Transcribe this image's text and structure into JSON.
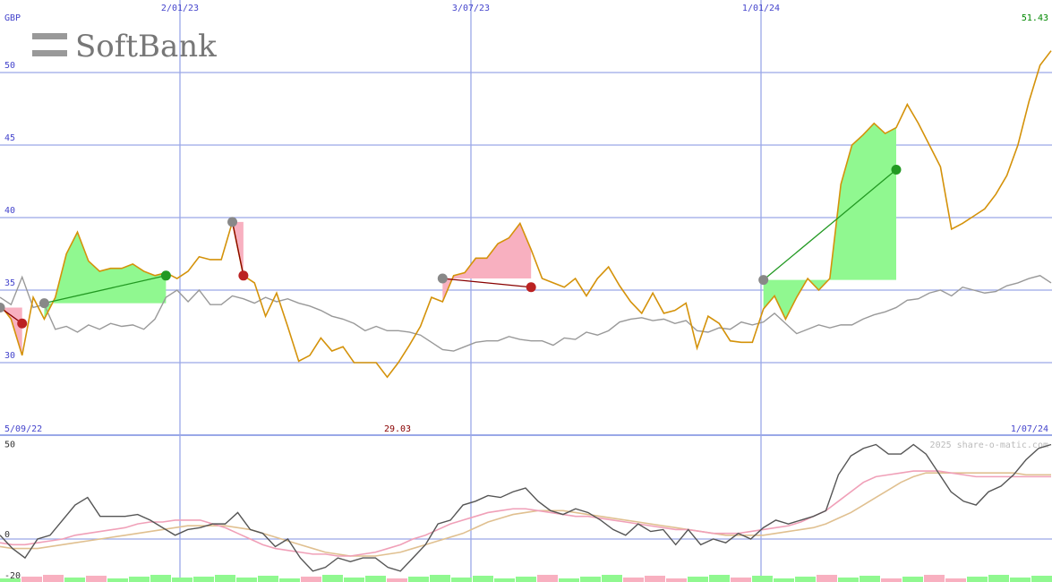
{
  "brand": {
    "name": "SoftBank"
  },
  "currency": "GBP",
  "last_price_label": "51.43",
  "min_price_label": "29.03",
  "start_date_label": "5/09/22",
  "end_date_label": "1/07/24",
  "watermark": "2025 share-o-matic.com",
  "colors": {
    "price": "#d4920a",
    "benchmark": "#999999",
    "grid": "#9aa8e8",
    "axis_text": "#4444cc",
    "gain_fill": "#90f890",
    "loss_fill": "#f8b0c0",
    "buy_marker": "#888888",
    "gain_marker": "#229922",
    "loss_marker": "#bb2222",
    "gain_line": "#229922",
    "loss_line": "#880000",
    "osc": "#555555",
    "osc_fast": "#f0a0b8",
    "osc_slow": "#e0c090",
    "last_label": "#008800",
    "min_label": "#880000"
  },
  "chart_data": [
    {
      "type": "line",
      "x_date_ticks": [
        "2/01/23",
        "3/07/23",
        "1/01/24"
      ],
      "ylabel": "GBP",
      "ylim": [
        27.5,
        52
      ],
      "y_ticks": [
        30,
        35,
        40,
        45,
        50
      ],
      "grid": true,
      "price": [
        34.0,
        33.0,
        30.5,
        34.5,
        33.0,
        34.5,
        37.5,
        39.0,
        37.0,
        36.3,
        36.5,
        36.5,
        36.8,
        36.3,
        36.0,
        36.2,
        35.8,
        36.3,
        37.3,
        37.1,
        37.1,
        39.7,
        36.0,
        35.5,
        33.2,
        34.8,
        32.5,
        30.1,
        30.5,
        31.7,
        30.8,
        31.1,
        30.0,
        30.0,
        30.0,
        29.0,
        30.0,
        31.2,
        32.5,
        34.5,
        34.2,
        36.0,
        36.2,
        37.2,
        37.2,
        38.2,
        38.6,
        39.6,
        37.8,
        35.8,
        35.5,
        35.2,
        35.8,
        34.6,
        35.8,
        36.6,
        35.3,
        34.2,
        33.4,
        34.8,
        33.4,
        33.6,
        34.1,
        31.0,
        33.2,
        32.7,
        31.5,
        31.4,
        31.4,
        33.7,
        34.6,
        33.0,
        34.5,
        35.8,
        35.0,
        35.8,
        42.3,
        45.0,
        45.7,
        46.5,
        45.8,
        46.2,
        47.8,
        46.5,
        45.0,
        43.5,
        39.2,
        39.6,
        40.1,
        40.6,
        41.6,
        42.9,
        45.0,
        48.0,
        50.5,
        51.5
      ],
      "benchmark": [
        34.5,
        34.0,
        35.9,
        33.8,
        34.0,
        32.3,
        32.5,
        32.1,
        32.6,
        32.3,
        32.7,
        32.5,
        32.6,
        32.3,
        33.0,
        34.5,
        35.0,
        34.2,
        35.0,
        34.0,
        34.0,
        34.6,
        34.4,
        34.1,
        34.5,
        34.2,
        34.4,
        34.1,
        33.9,
        33.6,
        33.2,
        33.0,
        32.7,
        32.2,
        32.5,
        32.2,
        32.2,
        32.1,
        31.9,
        31.4,
        30.9,
        30.8,
        31.1,
        31.4,
        31.5,
        31.5,
        31.8,
        31.6,
        31.5,
        31.5,
        31.2,
        31.7,
        31.6,
        32.1,
        31.9,
        32.2,
        32.8,
        33.0,
        33.1,
        32.9,
        33.0,
        32.7,
        32.9,
        32.2,
        32.1,
        32.4,
        32.3,
        32.8,
        32.6,
        32.8,
        33.4,
        32.7,
        32.0,
        32.3,
        32.6,
        32.4,
        32.6,
        32.6,
        33.0,
        33.3,
        33.5,
        33.8,
        34.3,
        34.4,
        34.8,
        35.0,
        34.6,
        35.2,
        35.0,
        34.8,
        34.9,
        35.3,
        35.5,
        35.8,
        36.0,
        35.5
      ],
      "trades": [
        {
          "entry_index": 0,
          "exit_index": 2,
          "entry_price": 33.8,
          "exit_price": 32.7,
          "result": "loss"
        },
        {
          "entry_index": 4,
          "exit_index": 15,
          "entry_price": 34.1,
          "exit_price": 36.0,
          "result": "gain"
        },
        {
          "entry_index": 21,
          "exit_index": 22,
          "entry_price": 39.7,
          "exit_price": 36.0,
          "result": "loss"
        },
        {
          "entry_index": 40,
          "exit_index": 48,
          "entry_price": 35.8,
          "exit_price": 35.2,
          "result": "loss"
        },
        {
          "entry_index": 69,
          "exit_index": 81,
          "entry_price": 35.7,
          "exit_price": 43.3,
          "result": "gain"
        }
      ]
    },
    {
      "type": "line",
      "ylim": [
        -20,
        50
      ],
      "y_ticks": [
        50,
        0,
        -20
      ],
      "series": [
        {
          "key": "osc",
          "values": [
            2,
            -5,
            -10,
            0,
            2,
            10,
            18,
            22,
            12,
            12,
            12,
            13,
            10,
            6,
            2,
            5,
            6,
            8,
            8,
            14,
            5,
            3,
            -4,
            0,
            -10,
            -17,
            -15,
            -10,
            -12,
            -10,
            -10,
            -15,
            -17,
            -10,
            -3,
            8,
            10,
            18,
            20,
            23,
            22,
            25,
            27,
            20,
            15,
            13,
            16,
            14,
            10,
            5,
            2,
            8,
            4,
            5,
            -3,
            5,
            -3,
            0,
            -2,
            3,
            0,
            6,
            10,
            8,
            10,
            12,
            15,
            34,
            44,
            48,
            50,
            45,
            45,
            50,
            45,
            35,
            25,
            20,
            18,
            25,
            28,
            34,
            42,
            48,
            50
          ]
        },
        {
          "key": "osc_fast",
          "values": [
            -2,
            -3,
            -3,
            -2,
            -1,
            0,
            2,
            3,
            4,
            5,
            6,
            8,
            9,
            9,
            10,
            10,
            10,
            8,
            6,
            3,
            0,
            -3,
            -5,
            -6,
            -7,
            -8,
            -8,
            -9,
            -9,
            -8,
            -7,
            -5,
            -3,
            0,
            2,
            5,
            8,
            10,
            12,
            14,
            15,
            16,
            16,
            15,
            14,
            13,
            12,
            12,
            11,
            10,
            9,
            8,
            7,
            6,
            5,
            5,
            4,
            3,
            3,
            3,
            4,
            5,
            6,
            7,
            9,
            12,
            15,
            20,
            25,
            30,
            33,
            34,
            35,
            36,
            36,
            36,
            35,
            34,
            33,
            33,
            33,
            33,
            33,
            33,
            33
          ]
        },
        {
          "key": "osc_slow",
          "values": [
            -4,
            -5,
            -5,
            -5,
            -4,
            -3,
            -2,
            -1,
            0,
            1,
            2,
            3,
            4,
            5,
            6,
            7,
            7,
            7,
            7,
            6,
            5,
            3,
            1,
            -1,
            -3,
            -5,
            -7,
            -8,
            -9,
            -9,
            -9,
            -8,
            -7,
            -5,
            -3,
            -1,
            1,
            3,
            6,
            9,
            11,
            13,
            14,
            15,
            15,
            15,
            14,
            13,
            12,
            11,
            10,
            9,
            8,
            7,
            6,
            5,
            4,
            3,
            2,
            2,
            2,
            2,
            3,
            4,
            5,
            6,
            8,
            11,
            14,
            18,
            22,
            26,
            30,
            33,
            35,
            35,
            35,
            35,
            35,
            35,
            35,
            35,
            34,
            34,
            34
          ]
        }
      ]
    }
  ]
}
